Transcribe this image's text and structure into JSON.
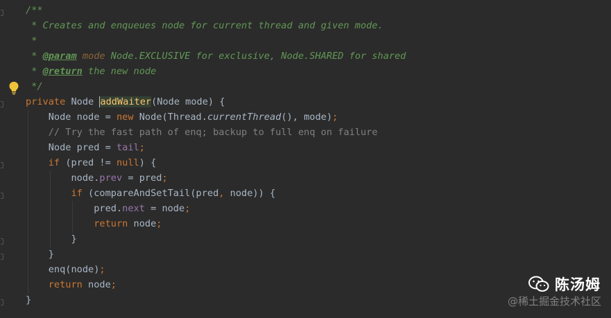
{
  "editor": {
    "lines": [
      {
        "indent": "",
        "tokens": [
          {
            "t": "/**",
            "c": "doc"
          }
        ]
      },
      {
        "indent": "",
        "tokens": [
          {
            "t": " * Creates and enqueues node for current thread and given mode.",
            "c": "doc"
          }
        ]
      },
      {
        "indent": "",
        "tokens": [
          {
            "t": " *",
            "c": "doc"
          }
        ]
      },
      {
        "indent": "",
        "tokens": [
          {
            "t": " * ",
            "c": "doc"
          },
          {
            "t": "@param",
            "c": "doctag"
          },
          {
            "t": " mode",
            "c": "docparam"
          },
          {
            "t": " Node.EXCLUSIVE for exclusive, Node.SHARED for shared",
            "c": "doc"
          }
        ]
      },
      {
        "indent": "",
        "tokens": [
          {
            "t": " * ",
            "c": "doc"
          },
          {
            "t": "@return",
            "c": "doctag"
          },
          {
            "t": " the new node",
            "c": "doc"
          }
        ]
      },
      {
        "indent": "",
        "tokens": [
          {
            "t": " */",
            "c": "doc"
          }
        ]
      },
      {
        "indent": "",
        "tokens": [
          {
            "t": "private ",
            "c": "kw"
          },
          {
            "t": "Node ",
            "c": "plain"
          },
          {
            "t": "|",
            "c": "caret"
          },
          {
            "t": "addWaiter",
            "c": "mth hl"
          },
          {
            "t": "(Node mode) {",
            "c": "plain"
          }
        ]
      },
      {
        "indent": "    ",
        "tokens": [
          {
            "t": "Node node = ",
            "c": "plain"
          },
          {
            "t": "new ",
            "c": "kw"
          },
          {
            "t": "Node(Thread.",
            "c": "plain"
          },
          {
            "t": "currentThread",
            "c": "plain ital"
          },
          {
            "t": "(), mode)",
            "c": "plain"
          },
          {
            "t": ";",
            "c": "kw"
          }
        ]
      },
      {
        "indent": "    ",
        "tokens": [
          {
            "t": "// Try the fast path of enq; backup to full enq on failure",
            "c": "cmt"
          }
        ]
      },
      {
        "indent": "    ",
        "tokens": [
          {
            "t": "Node pred = ",
            "c": "plain"
          },
          {
            "t": "tail",
            "c": "fld"
          },
          {
            "t": ";",
            "c": "kw"
          }
        ]
      },
      {
        "indent": "    ",
        "tokens": [
          {
            "t": "if ",
            "c": "kw"
          },
          {
            "t": "(pred != ",
            "c": "plain"
          },
          {
            "t": "null",
            "c": "kw"
          },
          {
            "t": ") {",
            "c": "plain"
          }
        ]
      },
      {
        "indent": "        ",
        "tokens": [
          {
            "t": "node.",
            "c": "plain"
          },
          {
            "t": "prev",
            "c": "fld"
          },
          {
            "t": " = pred",
            "c": "plain"
          },
          {
            "t": ";",
            "c": "kw"
          }
        ]
      },
      {
        "indent": "        ",
        "tokens": [
          {
            "t": "if ",
            "c": "kw"
          },
          {
            "t": "(compareAndSetTail(pred",
            "c": "plain"
          },
          {
            "t": ", ",
            "c": "kw"
          },
          {
            "t": "node)) {",
            "c": "plain"
          }
        ]
      },
      {
        "indent": "            ",
        "tokens": [
          {
            "t": "pred.",
            "c": "plain"
          },
          {
            "t": "next",
            "c": "fld"
          },
          {
            "t": " = node",
            "c": "plain"
          },
          {
            "t": ";",
            "c": "kw"
          }
        ]
      },
      {
        "indent": "            ",
        "tokens": [
          {
            "t": "return ",
            "c": "kw"
          },
          {
            "t": "node",
            "c": "plain"
          },
          {
            "t": ";",
            "c": "kw"
          }
        ]
      },
      {
        "indent": "        ",
        "tokens": [
          {
            "t": "}",
            "c": "plain"
          }
        ]
      },
      {
        "indent": "    ",
        "tokens": [
          {
            "t": "}",
            "c": "plain"
          }
        ]
      },
      {
        "indent": "    ",
        "tokens": [
          {
            "t": "enq(node)",
            "c": "plain"
          },
          {
            "t": ";",
            "c": "kw"
          }
        ]
      },
      {
        "indent": "    ",
        "tokens": [
          {
            "t": "return ",
            "c": "kw"
          },
          {
            "t": "node",
            "c": "plain"
          },
          {
            "t": ";",
            "c": "kw"
          }
        ]
      },
      {
        "indent": "",
        "tokens": [
          {
            "t": "}",
            "c": "plain"
          }
        ]
      }
    ]
  },
  "watermark": {
    "icon": "wechat-icon",
    "title": "陈汤姆",
    "subtitle": "@稀土掘金技术社区"
  },
  "colors": {
    "background": "#2b2b2b",
    "keyword": "#cc7832",
    "javadoc": "#629755",
    "field": "#9876aa",
    "method": "#ffc66d",
    "comment": "#808080",
    "text": "#a9b7c6"
  }
}
